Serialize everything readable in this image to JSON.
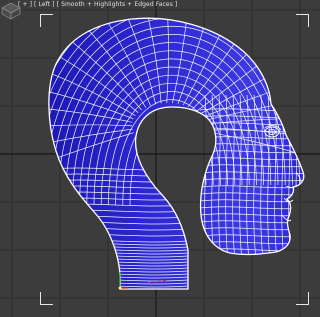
{
  "viewport": {
    "label": "[ + ] [ Left ] [ Smooth + Highlights + Edged Faces ]",
    "view_name": "Left",
    "shading_mode": "Smooth + Highlights + Edged Faces"
  },
  "colors": {
    "background": "#3c3c3c",
    "grid_line": "#2d2d2d",
    "grid_axis": "#1c1c1c",
    "mesh_fill": "#2a22c8",
    "mesh_fill_light": "#4a48ee",
    "wire": "#ffffff",
    "selection_corner": "#e6e6e6"
  },
  "icons": {
    "viewcube": "viewcube-icon",
    "pivot_gizmo": "axis-gizmo-icon"
  }
}
